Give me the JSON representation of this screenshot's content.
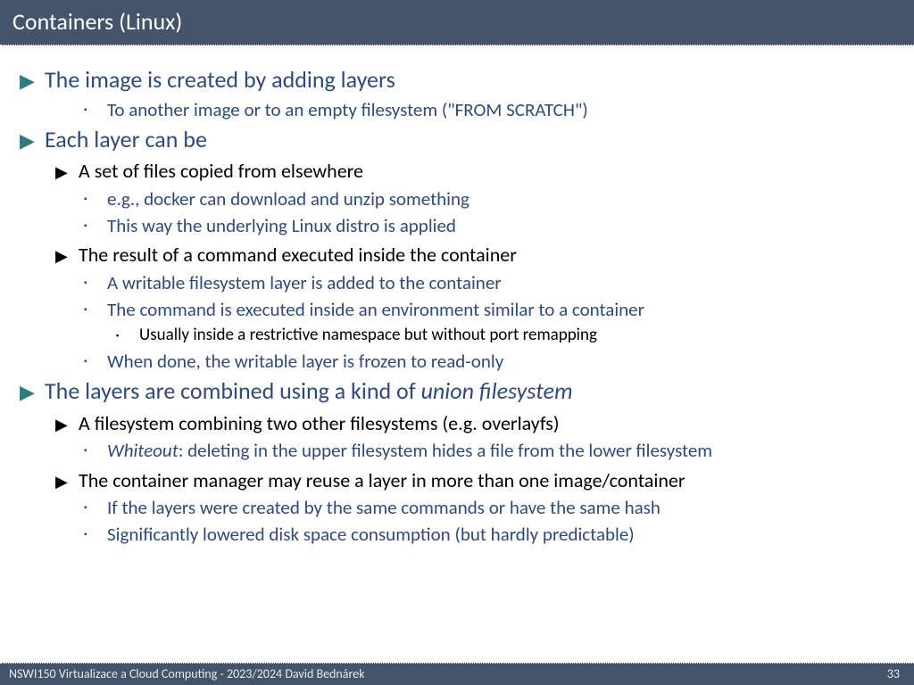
{
  "title": "Containers (Linux)",
  "footer": {
    "left": "NSWI150 Virtualizace a Cloud Computing - 2023/2024 David Bednárek",
    "page": "33"
  },
  "lines": [
    {
      "cls": "l1",
      "bul": "▶",
      "text": "The image is created by adding layers"
    },
    {
      "cls": "l2sq",
      "bul": "▪",
      "text": "To another image or to an empty filesystem (\"FROM SCRATCH\")"
    },
    {
      "cls": "l1",
      "bul": "▶",
      "text": "Each layer can be"
    },
    {
      "cls": "l2tri",
      "bul": "▶",
      "text": "A set of files copied from elsewhere"
    },
    {
      "cls": "l3sq",
      "bul": "▪",
      "text": "e.g., docker can download and unzip something"
    },
    {
      "cls": "l3sq",
      "bul": "▪",
      "text": "This way the underlying Linux distro is applied"
    },
    {
      "cls": "l2tri",
      "bul": "▶",
      "text": "The result of a command executed inside the container"
    },
    {
      "cls": "l3sq",
      "bul": "▪",
      "text": "A writable filesystem layer is added to the container"
    },
    {
      "cls": "l3sq",
      "bul": "▪",
      "text": "The command is executed inside an environment similar to a container"
    },
    {
      "cls": "l4sq",
      "bul": "▪",
      "text": "Usually inside a restrictive namespace but without port remapping"
    },
    {
      "cls": "l3sq",
      "bul": "▪",
      "text": "When done, the writable layer is frozen to read-only"
    },
    {
      "cls": "l1",
      "bul": "▶",
      "html": "The layers are combined using a kind of <span class=\"italic\">union filesystem</span>"
    },
    {
      "cls": "l2tri",
      "bul": "▶",
      "text": "A filesystem combining two other filesystems (e.g. overlayfs)"
    },
    {
      "cls": "l3sq",
      "bul": "▪",
      "html": "<span class=\"italic\">Whiteout</span>: deleting in the upper filesystem hides a file from the lower filesystem"
    },
    {
      "cls": "l2tri",
      "bul": "▶",
      "text": "The container manager may reuse a layer in more than one image/container"
    },
    {
      "cls": "l3sq",
      "bul": "▪",
      "text": "If the layers were created by the same commands or have the same hash"
    },
    {
      "cls": "l3sq",
      "bul": "▪",
      "text": "Significantly lowered disk space consumption (but hardly predictable)"
    }
  ]
}
